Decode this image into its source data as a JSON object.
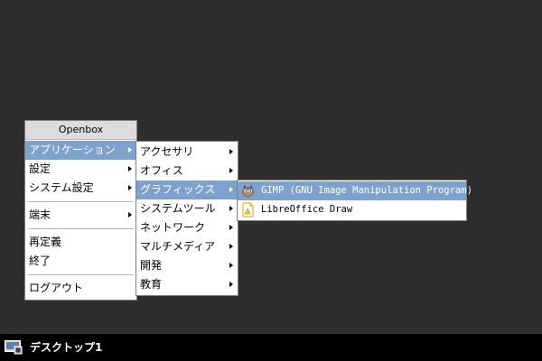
{
  "root_menu": {
    "title": "Openbox",
    "items": [
      {
        "label": "アプリケーション"
      },
      {
        "label": "設定"
      },
      {
        "label": "システム設定"
      },
      {
        "label": "端末"
      },
      {
        "label": "再定義"
      },
      {
        "label": "終了"
      },
      {
        "label": "ログアウト"
      }
    ]
  },
  "apps_menu": {
    "items": [
      {
        "label": "アクセサリ"
      },
      {
        "label": "オフィス"
      },
      {
        "label": "グラフィックス"
      },
      {
        "label": "システムツール"
      },
      {
        "label": "ネットワーク"
      },
      {
        "label": "マルチメディア"
      },
      {
        "label": "開発"
      },
      {
        "label": "教育"
      }
    ]
  },
  "graphics_menu": {
    "items": [
      {
        "label": "GIMP (GNU Image Manipulation Program)",
        "icon": "gimp-icon"
      },
      {
        "label": "LibreOffice Draw",
        "icon": "libreoffice-draw-icon"
      }
    ]
  },
  "taskbar": {
    "desktop_label": "デスクトップ1",
    "icon": "desktop-switcher-icon"
  },
  "colors": {
    "desktop_bg": "#2e2e2e",
    "highlight": "#7da2ce",
    "menu_title_bg": "#dcdcdc",
    "taskbar_bg": "#000000"
  }
}
